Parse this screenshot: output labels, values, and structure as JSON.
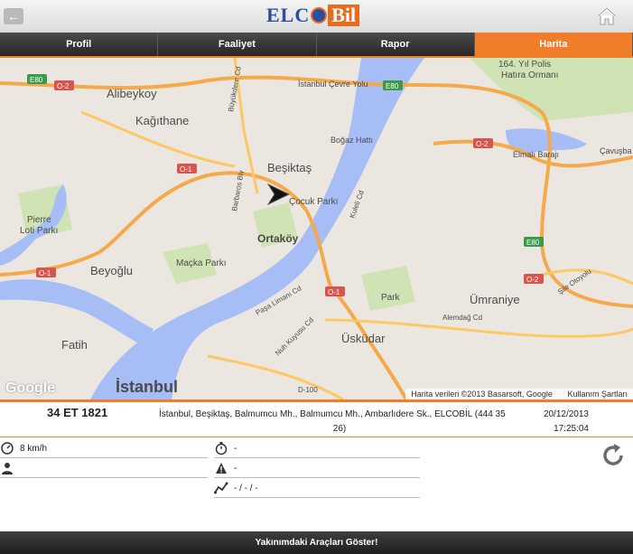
{
  "header": {
    "back_icon": "arrow-left-icon",
    "logo_left": "ELC",
    "logo_right": "Bil",
    "home_icon": "home-icon"
  },
  "tabs": [
    {
      "label": "Profil"
    },
    {
      "label": "Faaliyet"
    },
    {
      "label": "Rapor"
    },
    {
      "label": "Harita"
    }
  ],
  "active_tab": "Harita",
  "map": {
    "labels": {
      "alibeykoy": "Alibeykoy",
      "kagithane": "Kağıthane",
      "besiktas": "Beşiktaş",
      "cocuk_parki": "Çocuk Parkı",
      "ortakoy": "Ortaköy",
      "macka": "Maçka Parkı",
      "beyoglu": "Beyoğlu",
      "pierre": "Pierre",
      "loti": "Loti Parkı",
      "fatih": "Fatih",
      "istanbul": "İstanbul",
      "uskudar": "Üsküdar",
      "umraniye": "Ümraniye",
      "park": "Park",
      "polis": "164. Yıl Polis",
      "hatira": "Hatıra Ormanı",
      "elmali": "Elmalı Barajı",
      "cavusbasi": "Çavuşba",
      "bogaz_hatti": "Boğaz Hattı",
      "istanbul_cevre": "İstanbul Çevre Yolu",
      "alemdag": "Alemdağ Cd",
      "kuleli": "Kuleli Cd",
      "nuh_kuyusu": "Nuh Kuyusu Cd",
      "pasa_limani": "Paşa Limanı Cd",
      "d100": "D-100",
      "sile": "Şile Otoyolu",
      "barbaros": "Barbaros Blv",
      "buyukdere": "Büyükdere Cd"
    },
    "shields": [
      "E80",
      "O-2",
      "O-1"
    ],
    "attribution": "Harita verileri ©2013 Basarsoft, Google",
    "terms": "Kullanım Şartları",
    "google": "Google"
  },
  "vehicle": {
    "plate": "34 ET 1821",
    "address_line1": "İstanbul, Beşiktaş, Balmumcu Mh., Balmumcu Mh., Ambarlıdere Sk., ELCOBİL (444 35",
    "address_line2": "26)",
    "date": "20/12/2013",
    "time": "17:25:04"
  },
  "details": {
    "speed": "8 km/h",
    "speed_icon": "speedometer-icon",
    "driver": "",
    "driver_icon": "person-icon",
    "duration": "-",
    "duration_icon": "stopwatch-icon",
    "alarm": "-",
    "alarm_icon": "warning-icon",
    "trip": "- / - / -",
    "trip_icon": "route-icon",
    "refresh_icon": "refresh-icon"
  },
  "footer": {
    "nearby_button": "Yakınımdaki Araçları Göster!"
  },
  "colors": {
    "accent": "#f07d2a",
    "water": "#a6bdf5",
    "road": "#fdc765",
    "highway": "#f4a94a",
    "logo_blue": "#2b4f9e"
  }
}
